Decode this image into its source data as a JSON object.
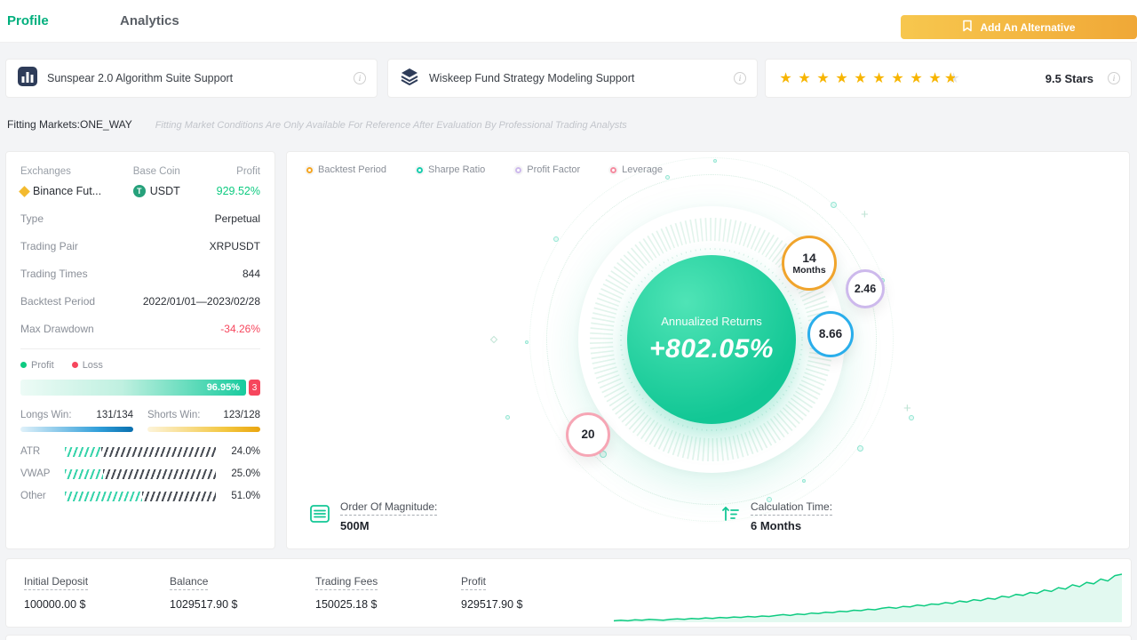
{
  "topbar": {
    "tabs": [
      {
        "label": "Profile",
        "active": true
      },
      {
        "label": "Analytics",
        "active": false
      }
    ],
    "add_button_label": "Add An Alternative"
  },
  "feature_cards": [
    {
      "title": "Sunspear 2.0 Algorithm Suite Support"
    },
    {
      "title": "Wiskeep Fund Strategy Modeling Support"
    }
  ],
  "rating_card": {
    "stars_full": 9,
    "stars_half": 1,
    "star_char": "★",
    "label": "9.5 Stars"
  },
  "fitting": {
    "label": "Fitting Markets:ONE_WAY",
    "note": "Fitting Market Conditions Are Only Available For Reference After Evaluation By Professional Trading Analysts"
  },
  "summary": {
    "exchanges_label": "Exchanges",
    "exchanges_value": "Binance Fut...",
    "base_coin_label": "Base Coin",
    "base_coin_value": "USDT",
    "profit_label": "Profit",
    "profit_value": "929.52%",
    "rows": [
      {
        "label": "Type",
        "value": "Perpetual"
      },
      {
        "label": "Trading Pair",
        "value": "XRPUSDT"
      },
      {
        "label": "Trading Times",
        "value": "844"
      },
      {
        "label": "Backtest Period",
        "value": "2022/01/01—2023/02/28"
      },
      {
        "label": "Max Drawdown",
        "value": "-34.26%"
      }
    ],
    "winloss": {
      "profit_legend": "Profit",
      "loss_legend": "Loss",
      "profit_pct_label": "96.95%",
      "loss_pct_label": "3",
      "longs_label": "Longs Win:",
      "longs_value": "131/134",
      "shorts_label": "Shorts Win:",
      "shorts_value": "123/128"
    },
    "weights": [
      {
        "label": "ATR",
        "pct": 24,
        "display": "24.0%"
      },
      {
        "label": "VWAP",
        "pct": 25,
        "display": "25.0%"
      },
      {
        "label": "Other",
        "pct": 51,
        "display": "51.0%"
      }
    ]
  },
  "gauge": {
    "legend": [
      {
        "label": "Backtest Period",
        "color": "#f5a623"
      },
      {
        "label": "Sharpe Ratio",
        "color": "#19cdae"
      },
      {
        "label": "Profit Factor",
        "color": "#cdb9ec"
      },
      {
        "label": "Leverage",
        "color": "#f58ba0"
      }
    ],
    "center": {
      "title": "Annualized Returns",
      "value": "+802.05%"
    },
    "badges": [
      {
        "value": "14",
        "sub": "Months",
        "color": "#f0a42c"
      },
      {
        "value": "2.46",
        "sub": "",
        "color": "#cdb9ec"
      },
      {
        "value": "8.66",
        "sub": "",
        "color": "#2aaeeb"
      },
      {
        "value": "20",
        "sub": "",
        "color": "#f6a6b5"
      }
    ],
    "magnitude": {
      "label": "Order Of Magnitude:",
      "value": "500M"
    },
    "calc_time": {
      "label": "Calculation Time:",
      "value": "6 Months"
    }
  },
  "footer": {
    "stats": [
      {
        "label": "Initial Deposit",
        "value": "100000.00 $"
      },
      {
        "label": "Balance",
        "value": "1029517.90 $"
      },
      {
        "label": "Trading Fees",
        "value": "150025.18 $"
      },
      {
        "label": "Profit",
        "value": "929517.90 $"
      }
    ],
    "sparkline": [
      0.03,
      0.04,
      0.03,
      0.05,
      0.04,
      0.06,
      0.05,
      0.04,
      0.06,
      0.07,
      0.06,
      0.08,
      0.07,
      0.09,
      0.08,
      0.1,
      0.09,
      0.11,
      0.1,
      0.12,
      0.11,
      0.13,
      0.12,
      0.14,
      0.16,
      0.14,
      0.17,
      0.16,
      0.19,
      0.18,
      0.21,
      0.2,
      0.23,
      0.22,
      0.25,
      0.24,
      0.27,
      0.26,
      0.29,
      0.31,
      0.29,
      0.33,
      0.32,
      0.36,
      0.34,
      0.38,
      0.37,
      0.41,
      0.39,
      0.44,
      0.42,
      0.47,
      0.45,
      0.5,
      0.48,
      0.54,
      0.52,
      0.58,
      0.56,
      0.62,
      0.6,
      0.67,
      0.64,
      0.72,
      0.69,
      0.78,
      0.74,
      0.83,
      0.8,
      0.9,
      0.86,
      0.97,
      1.0
    ]
  },
  "colors": {
    "accent_green": "#0ecb81",
    "negative_red": "#f6465d",
    "button_amber": "#f2b43f",
    "star_gold": "#f7b500",
    "long_bar_blue": "#0a6fae",
    "short_bar_yellow": "#eaa50f"
  }
}
